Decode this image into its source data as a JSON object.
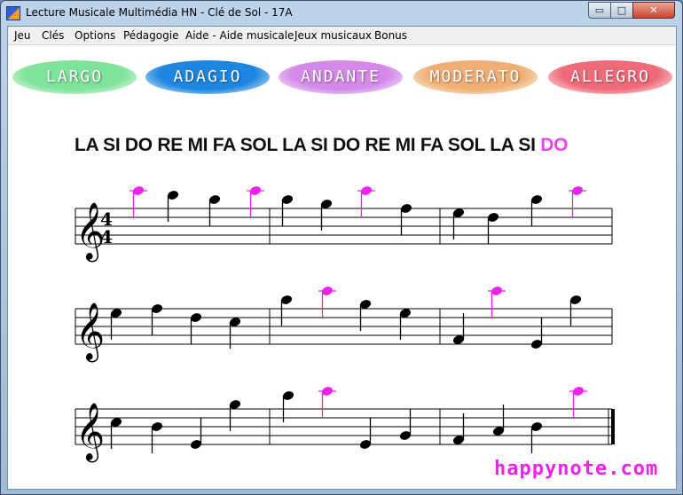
{
  "window": {
    "title": "Lecture Musicale Multimédia HN - Clé de Sol - 17A",
    "min_glyph": "▭",
    "max_glyph": "□",
    "close_glyph": "✕"
  },
  "menu": [
    "Jeu",
    "Clés",
    "Options",
    "Pédagogie",
    "Aide - Aide musicale",
    "Jeux musicaux",
    "Bonus"
  ],
  "tempo_buttons": [
    {
      "label": "LARGO",
      "color": "#7fe39a"
    },
    {
      "label": "ADAGIO",
      "color": "#1e86e0"
    },
    {
      "label": "ANDANTE",
      "color": "#d58ae9"
    },
    {
      "label": "MODERATO",
      "color": "#f0b075"
    },
    {
      "label": "ALLEGRO",
      "color": "#ef6b7a"
    }
  ],
  "sequence": {
    "text": "LA SI DO RE MI FA SOL LA SI DO RE MI FA SOL LA SI",
    "current": "DO"
  },
  "time_signature": {
    "top": "4",
    "bottom": "4"
  },
  "colors": {
    "note": "#000000",
    "target_note": "#ee22ee"
  },
  "staff_lines": [
    {
      "notes": [
        {
          "pitch": "C6",
          "target": true
        },
        {
          "pitch": "B5"
        },
        {
          "pitch": "A5"
        },
        {
          "pitch": "C6",
          "target": true
        },
        {
          "pitch": "A5",
          "bar": true
        },
        {
          "pitch": "G5"
        },
        {
          "pitch": "C6",
          "target": true
        },
        {
          "pitch": "F5"
        },
        {
          "pitch": "E5",
          "bar": true
        },
        {
          "pitch": "D5"
        },
        {
          "pitch": "A5"
        },
        {
          "pitch": "C6",
          "target": true
        }
      ]
    },
    {
      "notes": [
        {
          "pitch": "E5"
        },
        {
          "pitch": "F5"
        },
        {
          "pitch": "D5"
        },
        {
          "pitch": "C5"
        },
        {
          "pitch": "A5",
          "bar": true
        },
        {
          "pitch": "C6",
          "target": true
        },
        {
          "pitch": "G5"
        },
        {
          "pitch": "E5"
        },
        {
          "pitch": "F4",
          "bar": true
        },
        {
          "pitch": "C6",
          "target": true
        },
        {
          "pitch": "E4"
        },
        {
          "pitch": "A5"
        }
      ]
    },
    {
      "notes": [
        {
          "pitch": "C5"
        },
        {
          "pitch": "B4"
        },
        {
          "pitch": "E4"
        },
        {
          "pitch": "G5"
        },
        {
          "pitch": "B5",
          "bar": true
        },
        {
          "pitch": "C6",
          "target": true
        },
        {
          "pitch": "E4"
        },
        {
          "pitch": "G4"
        },
        {
          "pitch": "F4",
          "bar": true
        },
        {
          "pitch": "A4"
        },
        {
          "pitch": "B4"
        },
        {
          "pitch": "C6",
          "target": true
        }
      ],
      "final": true
    }
  ],
  "logo": "happynote.com"
}
